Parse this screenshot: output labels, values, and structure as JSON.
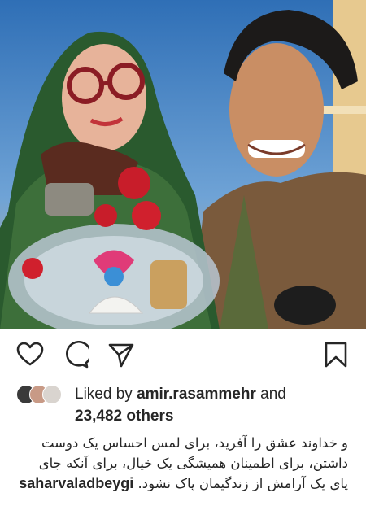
{
  "post": {
    "likes": {
      "prefix": "Liked by",
      "user": "amir.rasammehr",
      "conjunction": "and",
      "others": "23,482 others"
    },
    "caption": {
      "username": "saharvaladbeygi",
      "text": "و خداوند عشق را آفرید، برای لمس احساس یک دوست داشتن، برای اطمینان همیشگی یک خیال، برای آنکه جای پای یک آرامش از زندگیمان پاک نشود."
    }
  },
  "icons": {
    "like": "heart-icon",
    "comment": "comment-icon",
    "share": "paper-plane-icon",
    "save": "bookmark-icon"
  },
  "colors": {
    "text": "#262626",
    "background": "#ffffff"
  }
}
